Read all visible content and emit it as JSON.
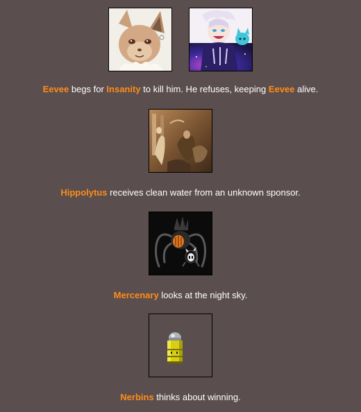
{
  "events": [
    {
      "tributes": [
        {
          "name": "Eevee",
          "icon": "eevee-portrait-icon"
        },
        {
          "name": "Insanity",
          "icon": "insanity-portrait-icon"
        }
      ],
      "segments": [
        {
          "text": "Eevee",
          "type": "name"
        },
        {
          "text": " begs for ",
          "type": "text"
        },
        {
          "text": "Insanity",
          "type": "name"
        },
        {
          "text": " to kill him. He refuses, keeping ",
          "type": "text"
        },
        {
          "text": "Eevee",
          "type": "name"
        },
        {
          "text": " alive.",
          "type": "text"
        }
      ]
    },
    {
      "tributes": [
        {
          "name": "Hippolytus",
          "icon": "hippolytus-portrait-icon"
        }
      ],
      "segments": [
        {
          "text": "Hippolytus",
          "type": "name"
        },
        {
          "text": " receives clean water from an unknown sponsor.",
          "type": "text"
        }
      ]
    },
    {
      "tributes": [
        {
          "name": "Mercenary",
          "icon": "mercenary-portrait-icon"
        }
      ],
      "segments": [
        {
          "text": "Mercenary",
          "type": "name"
        },
        {
          "text": " looks at the night sky.",
          "type": "text"
        }
      ]
    },
    {
      "tributes": [
        {
          "name": "Nerbins",
          "icon": "nerbins-portrait-icon"
        }
      ],
      "segments": [
        {
          "text": "Nerbins",
          "type": "name"
        },
        {
          "text": " thinks about winning.",
          "type": "text"
        }
      ]
    }
  ],
  "colors": {
    "background": "#5a4f4e",
    "tribute_name": "#ff8c1a",
    "text": "#ffffff"
  }
}
